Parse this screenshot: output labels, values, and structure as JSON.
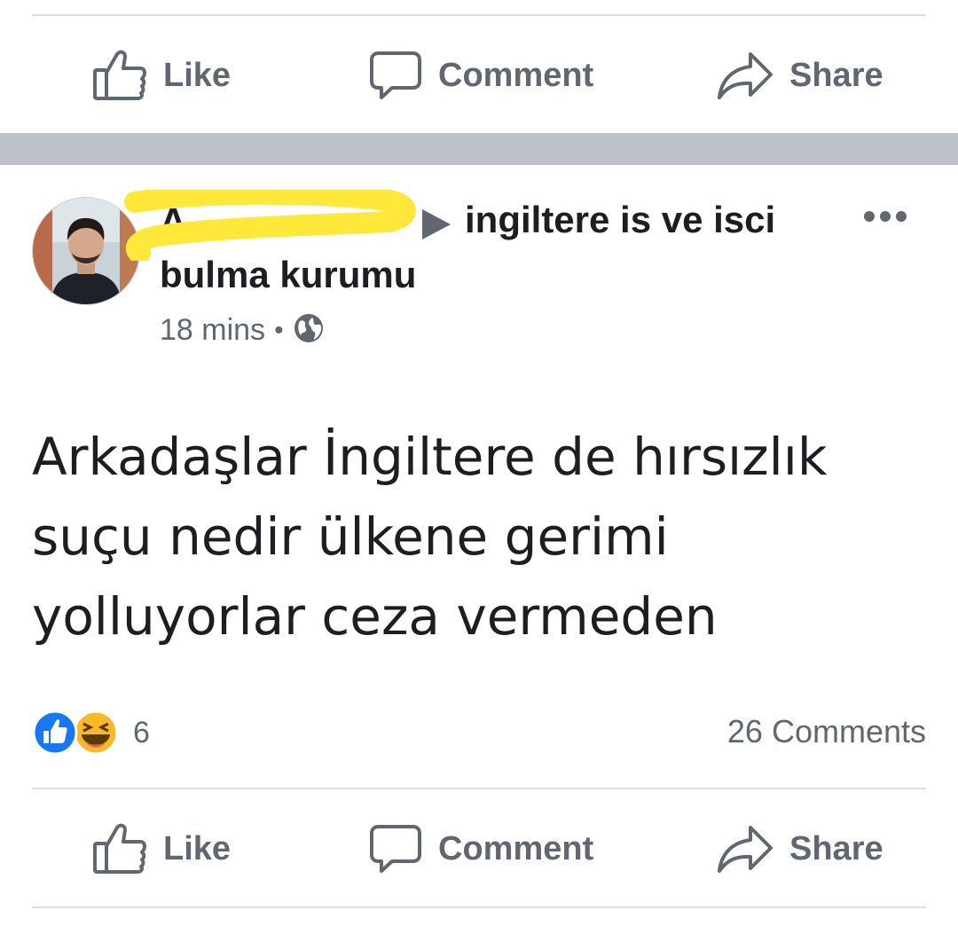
{
  "top_actions": {
    "like": "Like",
    "comment": "Comment",
    "share": "Share"
  },
  "post": {
    "author_name": "A",
    "group_line1": "ingiltere is ve isci",
    "group_line2": "bulma kurumu",
    "time": "18 mins",
    "meta_separator": "•",
    "privacy_icon": "globe-icon",
    "text_line1": "Arkadaşlar İngiltere de hırsızlık",
    "text_line2": "suçu nedir ülkene gerimi",
    "text_line3": "yolluyorlar ceza vermeden",
    "reaction_icons": [
      "like-reaction-icon",
      "haha-reaction-icon"
    ],
    "reaction_count": "6",
    "comments_count": "26 Comments"
  },
  "bottom_actions": {
    "like": "Like",
    "comment": "Comment",
    "share": "Share"
  },
  "colors": {
    "text": "#1c1e21",
    "secondary_text": "#606770",
    "divider": "#dadde1",
    "separator": "#bec3c9",
    "like_blue": "#1877f2",
    "haha_yellow": "#f7b928",
    "redaction_yellow": "#ffe83a"
  }
}
